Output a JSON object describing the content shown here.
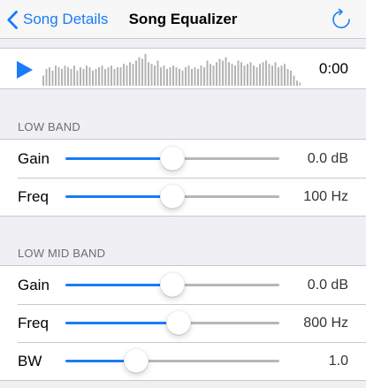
{
  "nav": {
    "back_label": "Song Details",
    "title": "Song Equalizer"
  },
  "player": {
    "time": "0:00",
    "waveform": [
      0.3,
      0.5,
      0.55,
      0.45,
      0.6,
      0.55,
      0.5,
      0.6,
      0.55,
      0.5,
      0.6,
      0.45,
      0.55,
      0.5,
      0.6,
      0.55,
      0.45,
      0.5,
      0.55,
      0.6,
      0.5,
      0.55,
      0.6,
      0.5,
      0.55,
      0.55,
      0.65,
      0.6,
      0.7,
      0.65,
      0.75,
      0.85,
      0.8,
      0.95,
      0.7,
      0.65,
      0.6,
      0.75,
      0.55,
      0.6,
      0.5,
      0.55,
      0.6,
      0.55,
      0.5,
      0.45,
      0.55,
      0.6,
      0.5,
      0.55,
      0.5,
      0.6,
      0.55,
      0.75,
      0.65,
      0.6,
      0.7,
      0.8,
      0.75,
      0.85,
      0.7,
      0.65,
      0.6,
      0.75,
      0.7,
      0.6,
      0.65,
      0.7,
      0.6,
      0.55,
      0.65,
      0.7,
      0.75,
      0.65,
      0.6,
      0.7,
      0.55,
      0.6,
      0.65,
      0.5,
      0.45,
      0.3,
      0.15,
      0.1
    ]
  },
  "sections": [
    {
      "header": "LOW BAND",
      "rows": [
        {
          "label": "Gain",
          "value": "0.0 dB",
          "level": 0.5
        },
        {
          "label": "Freq",
          "value": "100 Hz",
          "level": 0.5
        }
      ]
    },
    {
      "header": "LOW MID BAND",
      "rows": [
        {
          "label": "Gain",
          "value": "0.0 dB",
          "level": 0.5
        },
        {
          "label": "Freq",
          "value": "800 Hz",
          "level": 0.53
        },
        {
          "label": "BW",
          "value": "1.0",
          "level": 0.33
        }
      ]
    }
  ],
  "colors": {
    "accent": "#1a7cf9",
    "track": "#b7b7b7",
    "waveform": "#b4b4b4"
  },
  "icons": {
    "back": "chevron-left-icon",
    "refresh": "refresh-icon",
    "play": "play-icon"
  }
}
